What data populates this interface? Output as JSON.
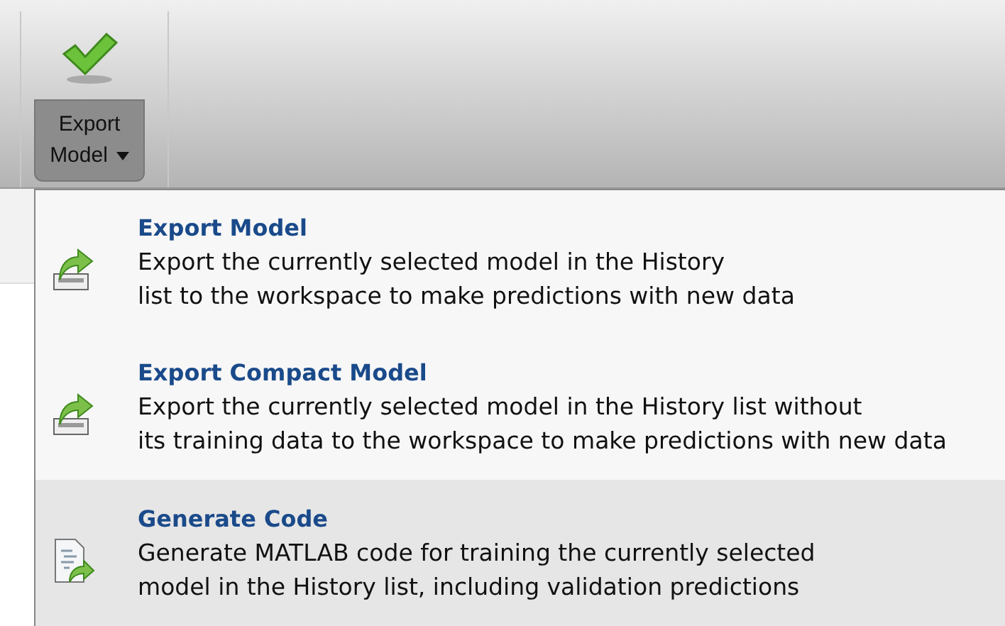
{
  "toolstrip": {
    "button": {
      "label_line1": "Export",
      "label_line2": "Model",
      "pressed": true
    }
  },
  "menu": {
    "items": [
      {
        "kind": "export",
        "title": "Export Model",
        "description_lines": [
          "Export the currently selected model in the History",
          "list to the workspace to make predictions with new data"
        ],
        "highlighted": false
      },
      {
        "kind": "export",
        "title": "Export Compact Model",
        "description_lines": [
          "Export the currently selected model in the History list without",
          "its training data to the workspace to make predictions with new data"
        ],
        "highlighted": false
      },
      {
        "kind": "code",
        "title": "Generate Code",
        "description_lines": [
          "Generate MATLAB code for training the currently selected",
          "model in the History list, including validation predictions"
        ],
        "highlighted": true
      }
    ]
  }
}
